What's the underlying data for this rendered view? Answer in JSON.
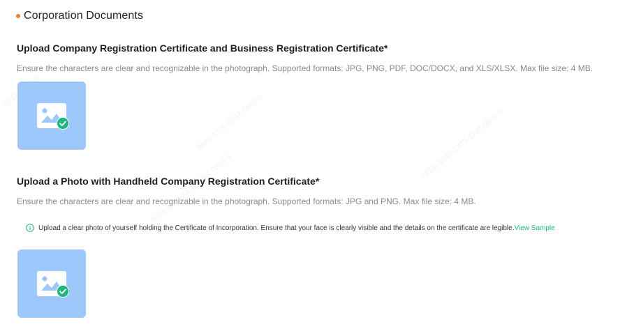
{
  "colors": {
    "accent_dot": "#f07a3e",
    "tile_bg": "#9ec8fb",
    "check_green": "#1fb57f",
    "link_green": "#1fb57f",
    "hint_gray": "#8a8a8a"
  },
  "section": {
    "title": "Corporation Documents"
  },
  "field1": {
    "title": "Upload Company Registration Certificate and Business Registration Certificate*",
    "hint": "Ensure the characters are clear and recognizable in the photograph. Supported formats: JPG, PNG, PDF, DOC/DOCX, and XLS/XLSX. Max file size: 4 MB.",
    "tile_icon": "image-icon",
    "status_icon": "check-circle-icon"
  },
  "field2": {
    "title": "Upload a Photo with Handheld Company Registration Certificate*",
    "hint": "Ensure the characters are clear and recognizable in the photograph. Supported formats: JPG and PNG. Max file size: 4 MB.",
    "notice_text": "Upload a clear photo of yourself holding the Certificate of Incorporation. Ensure that your face is clearly visible and the details on the certificate are legible.",
    "notice_link": "View Sample",
    "notice_icon": "info-circle-icon",
    "tile_icon": "image-icon",
    "status_icon": "check-circle-icon"
  },
  "watermarks": [
    "9797-0882-6",
    "3849-3379-9797-0882-6",
    "0086-3849-3379-9797-0882-6",
    "0086-3849-3379-9797-0882-6"
  ]
}
